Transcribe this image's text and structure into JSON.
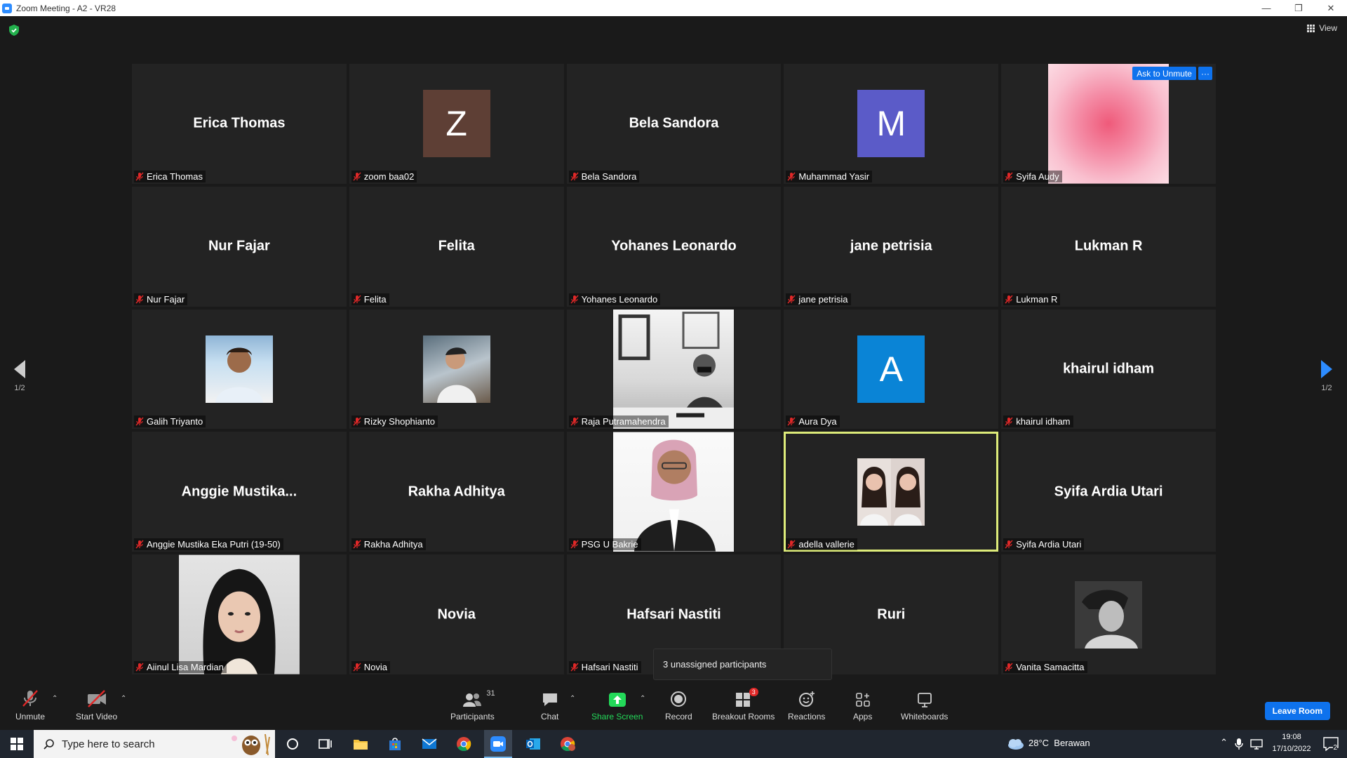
{
  "window": {
    "title": "Zoom Meeting - A2 - VR28",
    "minimize": "—",
    "restore": "❐",
    "close": "✕"
  },
  "header": {
    "view_label": "View"
  },
  "tiles": [
    {
      "big_name": "Erica Thomas",
      "name": "Erica Thomas"
    },
    {
      "avatar_letter": "Z",
      "avatar_color": "#5e3f35",
      "name": "zoom baa02"
    },
    {
      "big_name": "Bela Sandora",
      "name": "Bela Sandora"
    },
    {
      "avatar_letter": "M",
      "avatar_color": "#5b5bc8",
      "name": "Muhammad Yasir"
    },
    {
      "name": "Syifa Audy",
      "ask_to_unmute": "Ask to Unmute",
      "more_options": "···"
    },
    {
      "big_name": "Nur Fajar",
      "name": "Nur Fajar"
    },
    {
      "big_name": "Felita",
      "name": "Felita"
    },
    {
      "big_name": "Yohanes Leonardo",
      "name": "Yohanes Leonardo"
    },
    {
      "big_name": "jane petrisia",
      "name": "jane petrisia"
    },
    {
      "big_name": "Lukman R",
      "name": "Lukman R"
    },
    {
      "name": "Galih Triyanto"
    },
    {
      "name": "Rizky Shophianto"
    },
    {
      "name": "Raja Putramahendra"
    },
    {
      "avatar_letter": "A",
      "avatar_color": "#0a84d6",
      "name": "Aura Dya"
    },
    {
      "big_name": "khairul idham",
      "name": "khairul idham"
    },
    {
      "big_name": "Anggie  Mustika...",
      "name": "Anggie Mustika Eka Putri (19-50)"
    },
    {
      "big_name": "Rakha Adhitya",
      "name": "Rakha Adhitya"
    },
    {
      "name": "PSG U Bakrie"
    },
    {
      "name": "adella vallerie"
    },
    {
      "big_name": "Syifa Ardia Utari",
      "name": "Syifa Ardia Utari"
    },
    {
      "name": "Aiinul Lisa Mardian"
    },
    {
      "big_name": "Novia",
      "name": "Novia"
    },
    {
      "big_name": "Hafsari Nastiti",
      "name": "Hafsari Nastiti"
    },
    {
      "big_name": "Ruri"
    },
    {
      "name": "Vanita Samacitta"
    }
  ],
  "pagination": {
    "left": "1/2",
    "right": "1/2"
  },
  "toast": "3 unassigned participants",
  "toolbar": {
    "unmute": "Unmute",
    "start_video": "Start Video",
    "participants": "Participants",
    "participants_count": "31",
    "chat": "Chat",
    "share_screen": "Share Screen",
    "record": "Record",
    "breakout_rooms": "Breakout Rooms",
    "breakout_badge": "3",
    "reactions": "Reactions",
    "apps": "Apps",
    "whiteboards": "Whiteboards",
    "leave_room": "Leave Room"
  },
  "colors": {
    "accent": "#0e72ed",
    "share_green": "#23d959",
    "active_speaker": "#ddeb7a",
    "muted_red": "#e02828",
    "badge_red": "#e02828"
  },
  "taskbar": {
    "search_placeholder": "Type here to search",
    "weather": "28°C  Berawan",
    "time": "19:08",
    "date": "17/10/2022",
    "notification_count": "2"
  }
}
